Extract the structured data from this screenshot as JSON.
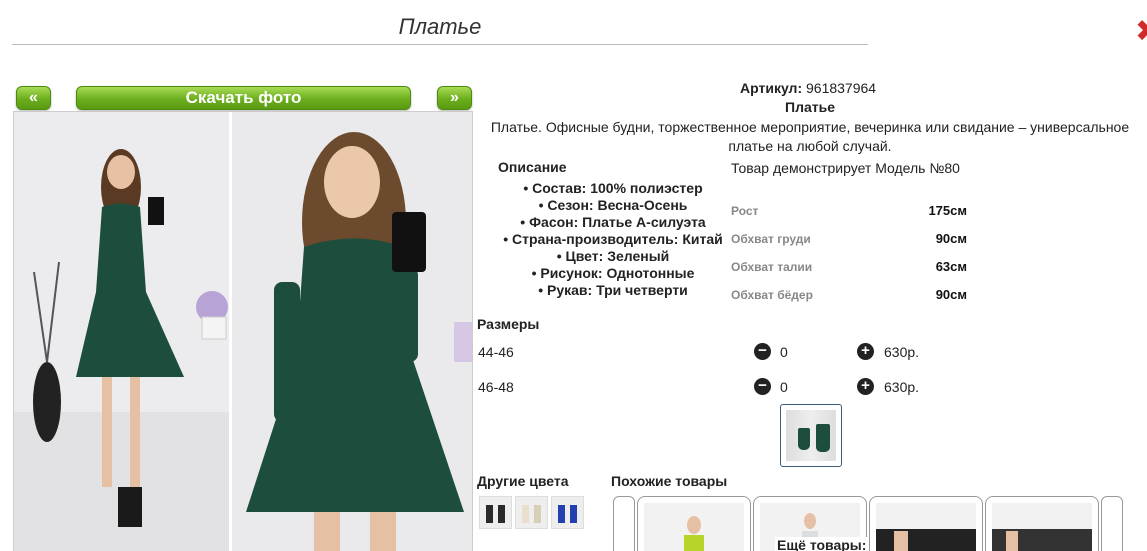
{
  "header": {
    "title": "Платье",
    "close_icon": "close-icon"
  },
  "nav": {
    "prev_label": "«",
    "download_label": "Скачать фото",
    "next_label": "»"
  },
  "product": {
    "article_label": "Артикул:",
    "article_value": "961837964",
    "name": "Платье",
    "description": "Платье. Офисные будни, торжественное мероприятие, вечеринка или свидание – универсальное платье на любой случай."
  },
  "specs": {
    "heading": "Описание",
    "items": [
      "Состав: 100% полиэстер",
      "Сезон: Весна-Осень",
      "Фасон: Платье А-силуэта",
      "Страна-производитель: Китай",
      "Цвет: Зеленый",
      "Рисунок: Однотонные",
      "Рукав: Три четверти"
    ]
  },
  "model": {
    "title": "Товар демонстрирует Модель №80",
    "measurements": [
      {
        "label": "Рост",
        "value": "175см"
      },
      {
        "label": "Обхват груди",
        "value": "90см"
      },
      {
        "label": "Обхват талии",
        "value": "63см"
      },
      {
        "label": "Обхват бёдер",
        "value": "90см"
      }
    ]
  },
  "sizes": {
    "heading": "Размеры",
    "rows": [
      {
        "size": "44-46",
        "qty": "0",
        "price": "630р."
      },
      {
        "size": "46-48",
        "qty": "0",
        "price": "630р."
      }
    ]
  },
  "other_colors": {
    "heading": "Другие цвета",
    "colors": [
      "#2a2a2a",
      "#e8e0cc",
      "#2440b0"
    ]
  },
  "similar": {
    "heading": "Похожие товары",
    "more_label": "Ещё товары:"
  },
  "colors": {
    "accent_green": "#6cae1e",
    "dress_green": "#1d4d3c",
    "close_red": "#d12a2a"
  }
}
